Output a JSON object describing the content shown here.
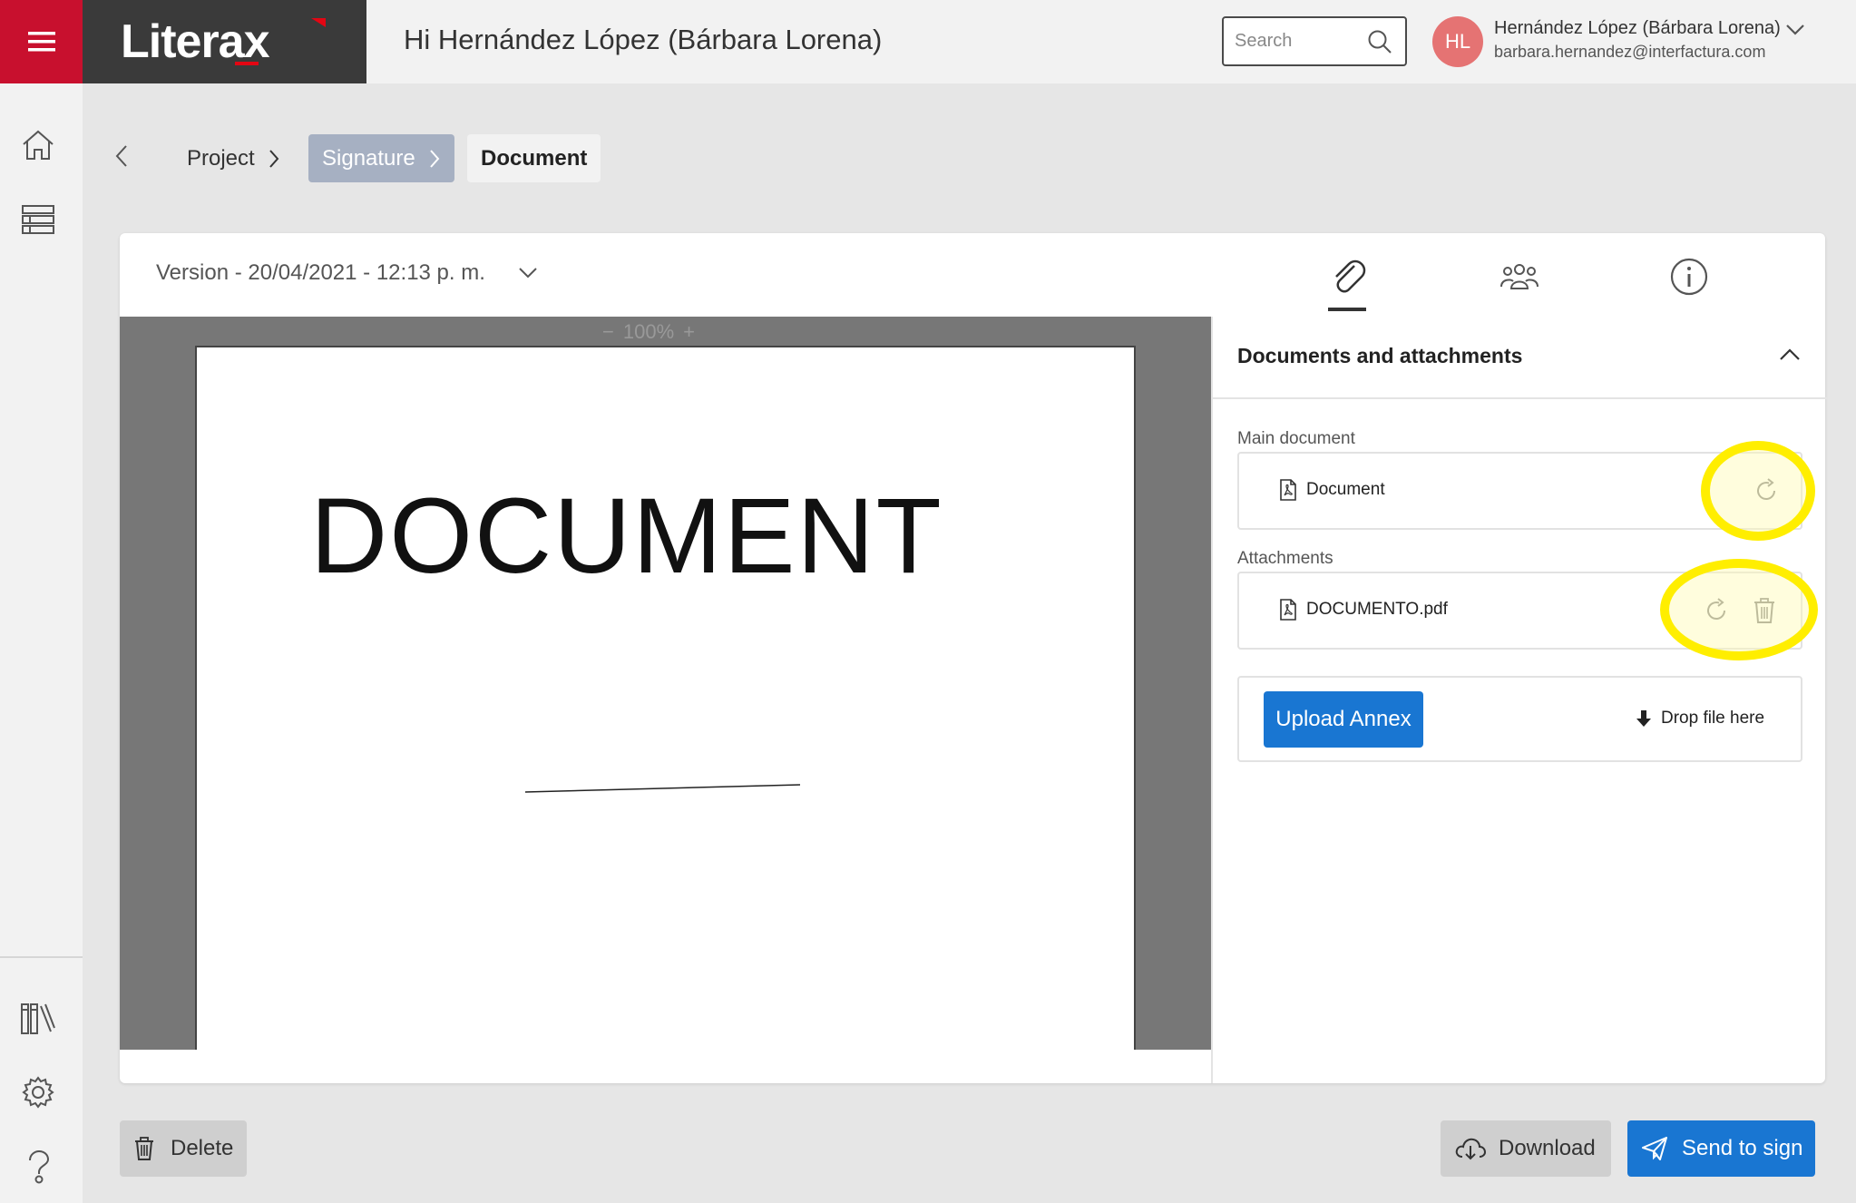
{
  "header": {
    "logo": "Literax",
    "greeting": "Hi Hernández López (Bárbara Lorena)",
    "search_placeholder": "Search",
    "user_initials": "HL",
    "user_name": "Hernández López (Bárbara Lorena)",
    "user_email": "barbara.hernandez@interfactura.com"
  },
  "breadcrumb": {
    "items": [
      "Project",
      "Signature",
      "Document"
    ]
  },
  "card": {
    "version_label": "Version - 20/04/2021 - 12:13 p. m.",
    "tabs": [
      "paperclip-icon",
      "users-icon",
      "info-icon"
    ],
    "active_tab": 0
  },
  "viewer": {
    "zoom_minus": "−",
    "zoom_level": "100%",
    "zoom_plus": "+",
    "document_heading": "DOCUMENT"
  },
  "panel": {
    "title": "Documents and attachments",
    "main_document_label": "Main document",
    "main_document_name": "Document",
    "attachments_label": "Attachments",
    "attachment_name": "DOCUMENTO.pdf",
    "upload_button": "Upload Annex",
    "drop_text": "Drop file here"
  },
  "footer": {
    "delete": "Delete",
    "download": "Download",
    "send_to_sign": "Send to sign"
  },
  "colors": {
    "brand_red": "#c8102e",
    "primary_blue": "#1976d2",
    "highlight_yellow": "#ffee00",
    "breadcrumb_active": "#a6b0c2"
  }
}
